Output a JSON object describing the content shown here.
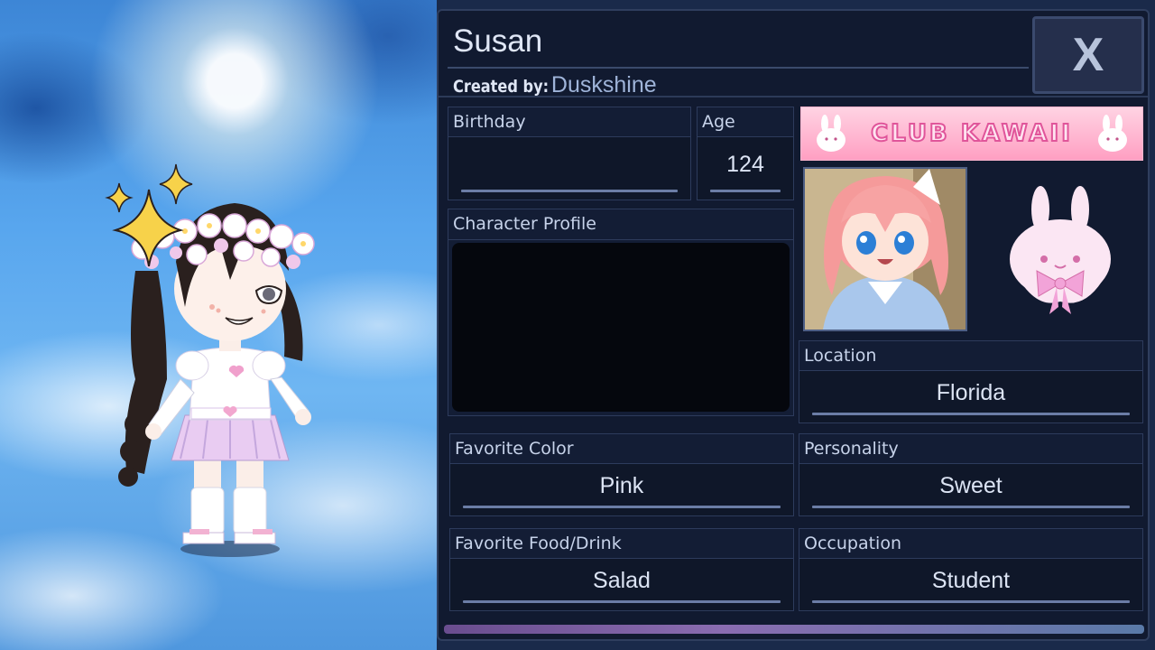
{
  "character": {
    "name": "Susan",
    "created_by_label": "Created by:",
    "creator": "Duskshine"
  },
  "close_button": {
    "label": "X"
  },
  "fields": {
    "birthday": {
      "label": "Birthday",
      "value": ""
    },
    "age": {
      "label": "Age",
      "value": "124"
    },
    "character_profile": {
      "label": "Character Profile",
      "value": ""
    },
    "location": {
      "label": "Location",
      "value": "Florida"
    },
    "favorite_color": {
      "label": "Favorite Color",
      "value": "Pink"
    },
    "personality": {
      "label": "Personality",
      "value": "Sweet"
    },
    "favorite_food": {
      "label": "Favorite Food/Drink",
      "value": "Salad"
    },
    "occupation": {
      "label": "Occupation",
      "value": "Student"
    }
  },
  "banner": {
    "text": "CLUB KAWAII"
  },
  "colors": {
    "panel_bg": "#111a30",
    "field_border": "#2d3b5c",
    "banner_pink": "#ff9fc2",
    "text": "#dce4f4"
  }
}
